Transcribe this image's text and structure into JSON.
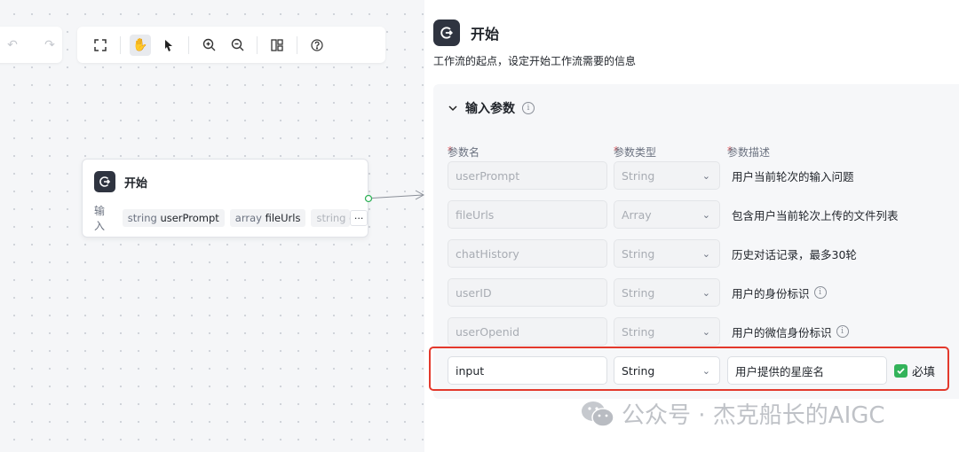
{
  "node": {
    "title": "开始",
    "inputs_label": "输入",
    "chips": [
      {
        "type": "string",
        "name": "userPrompt"
      },
      {
        "type": "array",
        "name": "fileUrls"
      },
      {
        "type": "string",
        "name": "c"
      }
    ],
    "more_label": "···"
  },
  "panel": {
    "title": "开始",
    "description": "工作流的起点，设定开始工作流需要的信息",
    "section_title": "输入参数",
    "columns": {
      "name": "参数名",
      "type": "参数类型",
      "desc": "参数描述"
    },
    "params": [
      {
        "name": "userPrompt",
        "type": "String",
        "desc": "用户当前轮次的输入问题",
        "info": false
      },
      {
        "name": "fileUrls",
        "type": "Array",
        "desc": "包含用户当前轮次上传的文件列表",
        "info": false
      },
      {
        "name": "chatHistory",
        "type": "String",
        "desc": "历史对话记录，最多30轮",
        "info": false
      },
      {
        "name": "userID",
        "type": "String",
        "desc": "用户的身份标识",
        "info": true
      },
      {
        "name": "userOpenid",
        "type": "String",
        "desc": "用户的微信身份标识",
        "info": true
      }
    ],
    "custom_param": {
      "name": "input",
      "type": "String",
      "desc": "用户提供的星座名",
      "required_label": "必填",
      "required": true
    }
  },
  "watermark": "公众号 · 杰克船长的AIGC",
  "colors": {
    "accent_dark": "#2f3440",
    "highlight": "#e3392c",
    "check": "#33b35a",
    "required_star": "#e5484d"
  }
}
